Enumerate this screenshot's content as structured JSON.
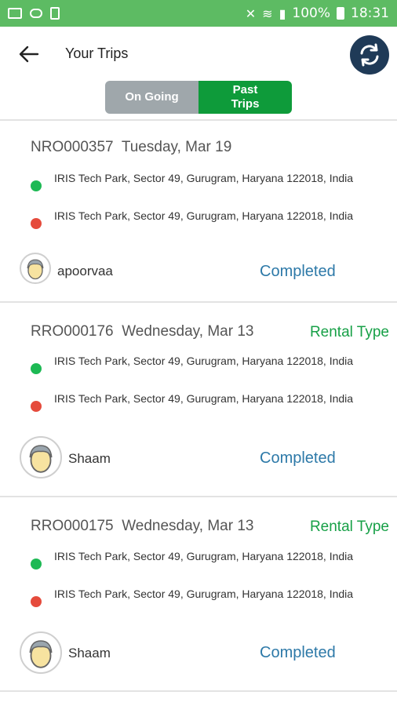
{
  "status_bar": {
    "battery": "100%",
    "time": "18:31"
  },
  "header": {
    "title": "Your Trips"
  },
  "tabs": [
    {
      "label": "On Going"
    },
    {
      "label": "Past Trips"
    }
  ],
  "trips": [
    {
      "id": "NRO000357",
      "date": "Tuesday, Mar 19",
      "rental": "",
      "pickup": "IRIS Tech Park, Sector 49, Gurugram, Haryana 122018, India",
      "drop": "IRIS Tech Park, Sector 49, Gurugram, Haryana 122018, India",
      "driver": "apoorvaa",
      "status": "Completed"
    },
    {
      "id": "RRO000176",
      "date": "Wednesday, Mar 13",
      "rental": "Rental Type",
      "pickup": "IRIS Tech Park, Sector 49, Gurugram, Haryana 122018, India",
      "drop": "IRIS Tech Park, Sector 49, Gurugram, Haryana 122018, India",
      "driver": "Shaam",
      "status": "Completed"
    },
    {
      "id": "RRO000175",
      "date": "Wednesday, Mar 13",
      "rental": "Rental Type",
      "pickup": "IRIS Tech Park, Sector 49, Gurugram, Haryana 122018, India",
      "drop": "IRIS Tech Park, Sector 49, Gurugram, Haryana 122018, India",
      "driver": "Shaam",
      "status": "Completed"
    }
  ],
  "colors": {
    "status_bar": "#5dbb63",
    "active_tab": "#0e9b3a",
    "inactive_tab": "#9fa7ab",
    "refresh_button": "#1f3a57",
    "completed": "#2d79a8",
    "rental": "#17a047",
    "pickup_dot": "#1db954",
    "drop_dot": "#e54b3c"
  },
  "icons": {
    "back": "arrow-left-icon",
    "refresh": "refresh-icon",
    "pickup": "green-dot-icon",
    "drop": "red-dot-icon",
    "avatar": "user-avatar-icon"
  }
}
